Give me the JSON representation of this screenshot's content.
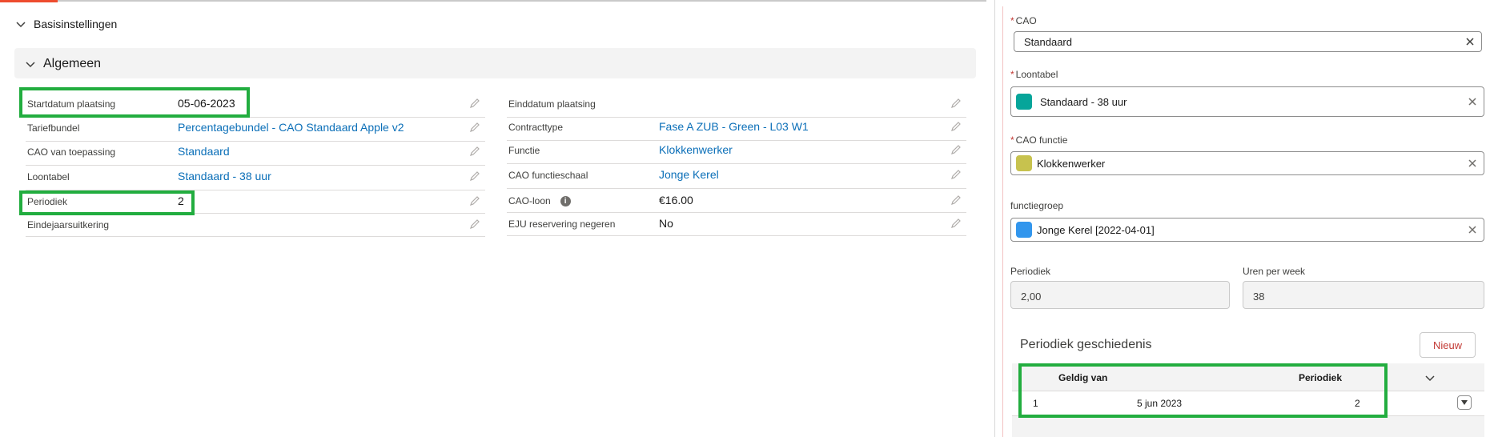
{
  "sections": {
    "basis": "Basisinstellingen",
    "algemeen": "Algemeen"
  },
  "left_fields": [
    {
      "label": "Startdatum plaatsing",
      "value": "05-06-2023",
      "link": false
    },
    {
      "label": "Tariefbundel",
      "value": "Percentagebundel - CAO Standaard Apple v2",
      "link": true
    },
    {
      "label": "CAO van toepassing",
      "value": "Standaard",
      "link": true
    },
    {
      "label": "Loontabel",
      "value": "Standaard - 38 uur",
      "link": true
    },
    {
      "label": "Periodiek",
      "value": "2",
      "link": false
    },
    {
      "label": "Eindejaarsuitkering",
      "value": "",
      "link": false
    }
  ],
  "right_fields": [
    {
      "label": "Einddatum plaatsing",
      "value": "",
      "link": false
    },
    {
      "label": "Contracttype",
      "value": "Fase A ZUB - Green - L03 W1",
      "link": true
    },
    {
      "label": "Functie",
      "value": "Klokkenwerker",
      "link": true
    },
    {
      "label": "CAO functieschaal",
      "value": "Jonge Kerel",
      "link": true
    },
    {
      "label": "CAO-loon",
      "value": "€16.00",
      "link": false,
      "info": "i"
    },
    {
      "label": "EJU reservering negeren",
      "value": "No",
      "link": false
    }
  ],
  "panel": {
    "required_mark": "*",
    "cao": {
      "label": "CAO",
      "value": "Standaard"
    },
    "loontabel": {
      "label": "Loontabel",
      "value": "Standaard - 38 uur",
      "badge_color": "#06a59a"
    },
    "cao_functie": {
      "label": "CAO functie",
      "value": "Klokkenwerker",
      "badge_color": "#c7c24e"
    },
    "functiegroep": {
      "label": "functiegroep",
      "value": "Jonge Kerel [2022-04-01]",
      "badge_color": "#3296ed"
    },
    "periodiek": {
      "label": "Periodiek",
      "value": "2,00"
    },
    "uren": {
      "label": "Uren per week",
      "value": "38"
    }
  },
  "history": {
    "title": "Periodiek geschiedenis",
    "new_button": "Nieuw",
    "columns": [
      "Geldig van",
      "Periodiek"
    ],
    "rows": [
      {
        "num": "1",
        "geldig_van": "5 jun 2023",
        "periodiek": "2"
      }
    ]
  },
  "colors": {
    "highlight": "#22ad3f",
    "link": "#0b6fb8",
    "accent": "#ee4c2e"
  }
}
